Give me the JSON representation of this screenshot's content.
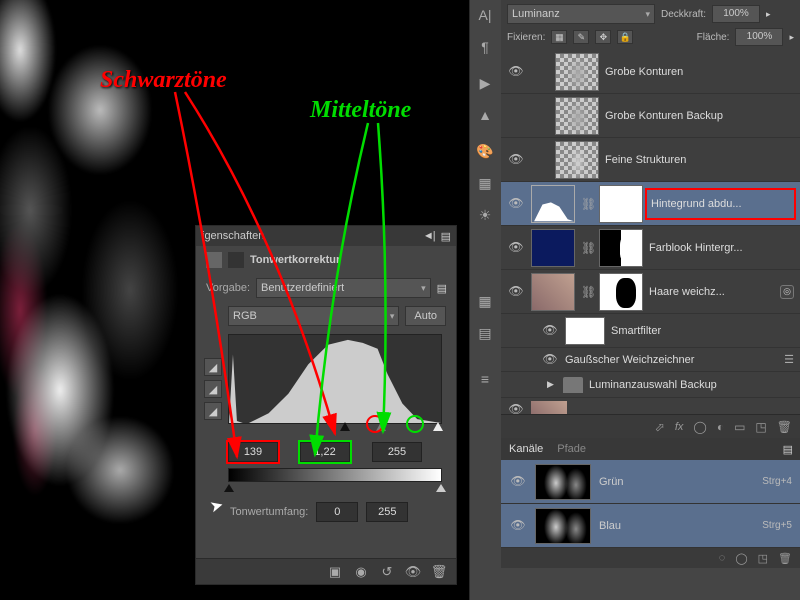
{
  "annotations": {
    "schwarz": "Schwarztöne",
    "mittel": "Mitteltöne"
  },
  "properties": {
    "panel_title": "igenschaften",
    "adjustment_title": "Tonwertkorrektur",
    "preset_label": "Vorgabe:",
    "preset_value": "Benutzerdefiniert",
    "channel_value": "RGB",
    "auto_label": "Auto",
    "input_black": "139",
    "input_mid": "1,22",
    "input_white": "255",
    "output_label": "Tonwertumfang:",
    "output_black": "0",
    "output_white": "255"
  },
  "layer_opts": {
    "blend_value": "Luminanz",
    "opacity_label": "Deckkraft:",
    "opacity_value": "100%",
    "lock_label": "Fixieren:",
    "fill_label": "Fläche:",
    "fill_value": "100%"
  },
  "layers": {
    "l1": "Grobe Konturen",
    "l2": "Grobe Konturen Backup",
    "l3": "Feine Strukturen",
    "l4": "Hintegrund abdu...",
    "l5": "Farblook Hintergr...",
    "l6": "Haare weichz...",
    "l7": "Smartfilter",
    "l8": "Gaußscher Weichzeichner",
    "g1": "Luminanzauswahl Backup",
    "fx": "fx"
  },
  "channels": {
    "tab1": "Kanäle",
    "tab2": "Pfade",
    "c1": "Grün",
    "c1s": "Strg+4",
    "c2": "Blau",
    "c2s": "Strg+5"
  },
  "icons": {
    "eye": "👁",
    "link": "⛓",
    "menu": "≡"
  }
}
